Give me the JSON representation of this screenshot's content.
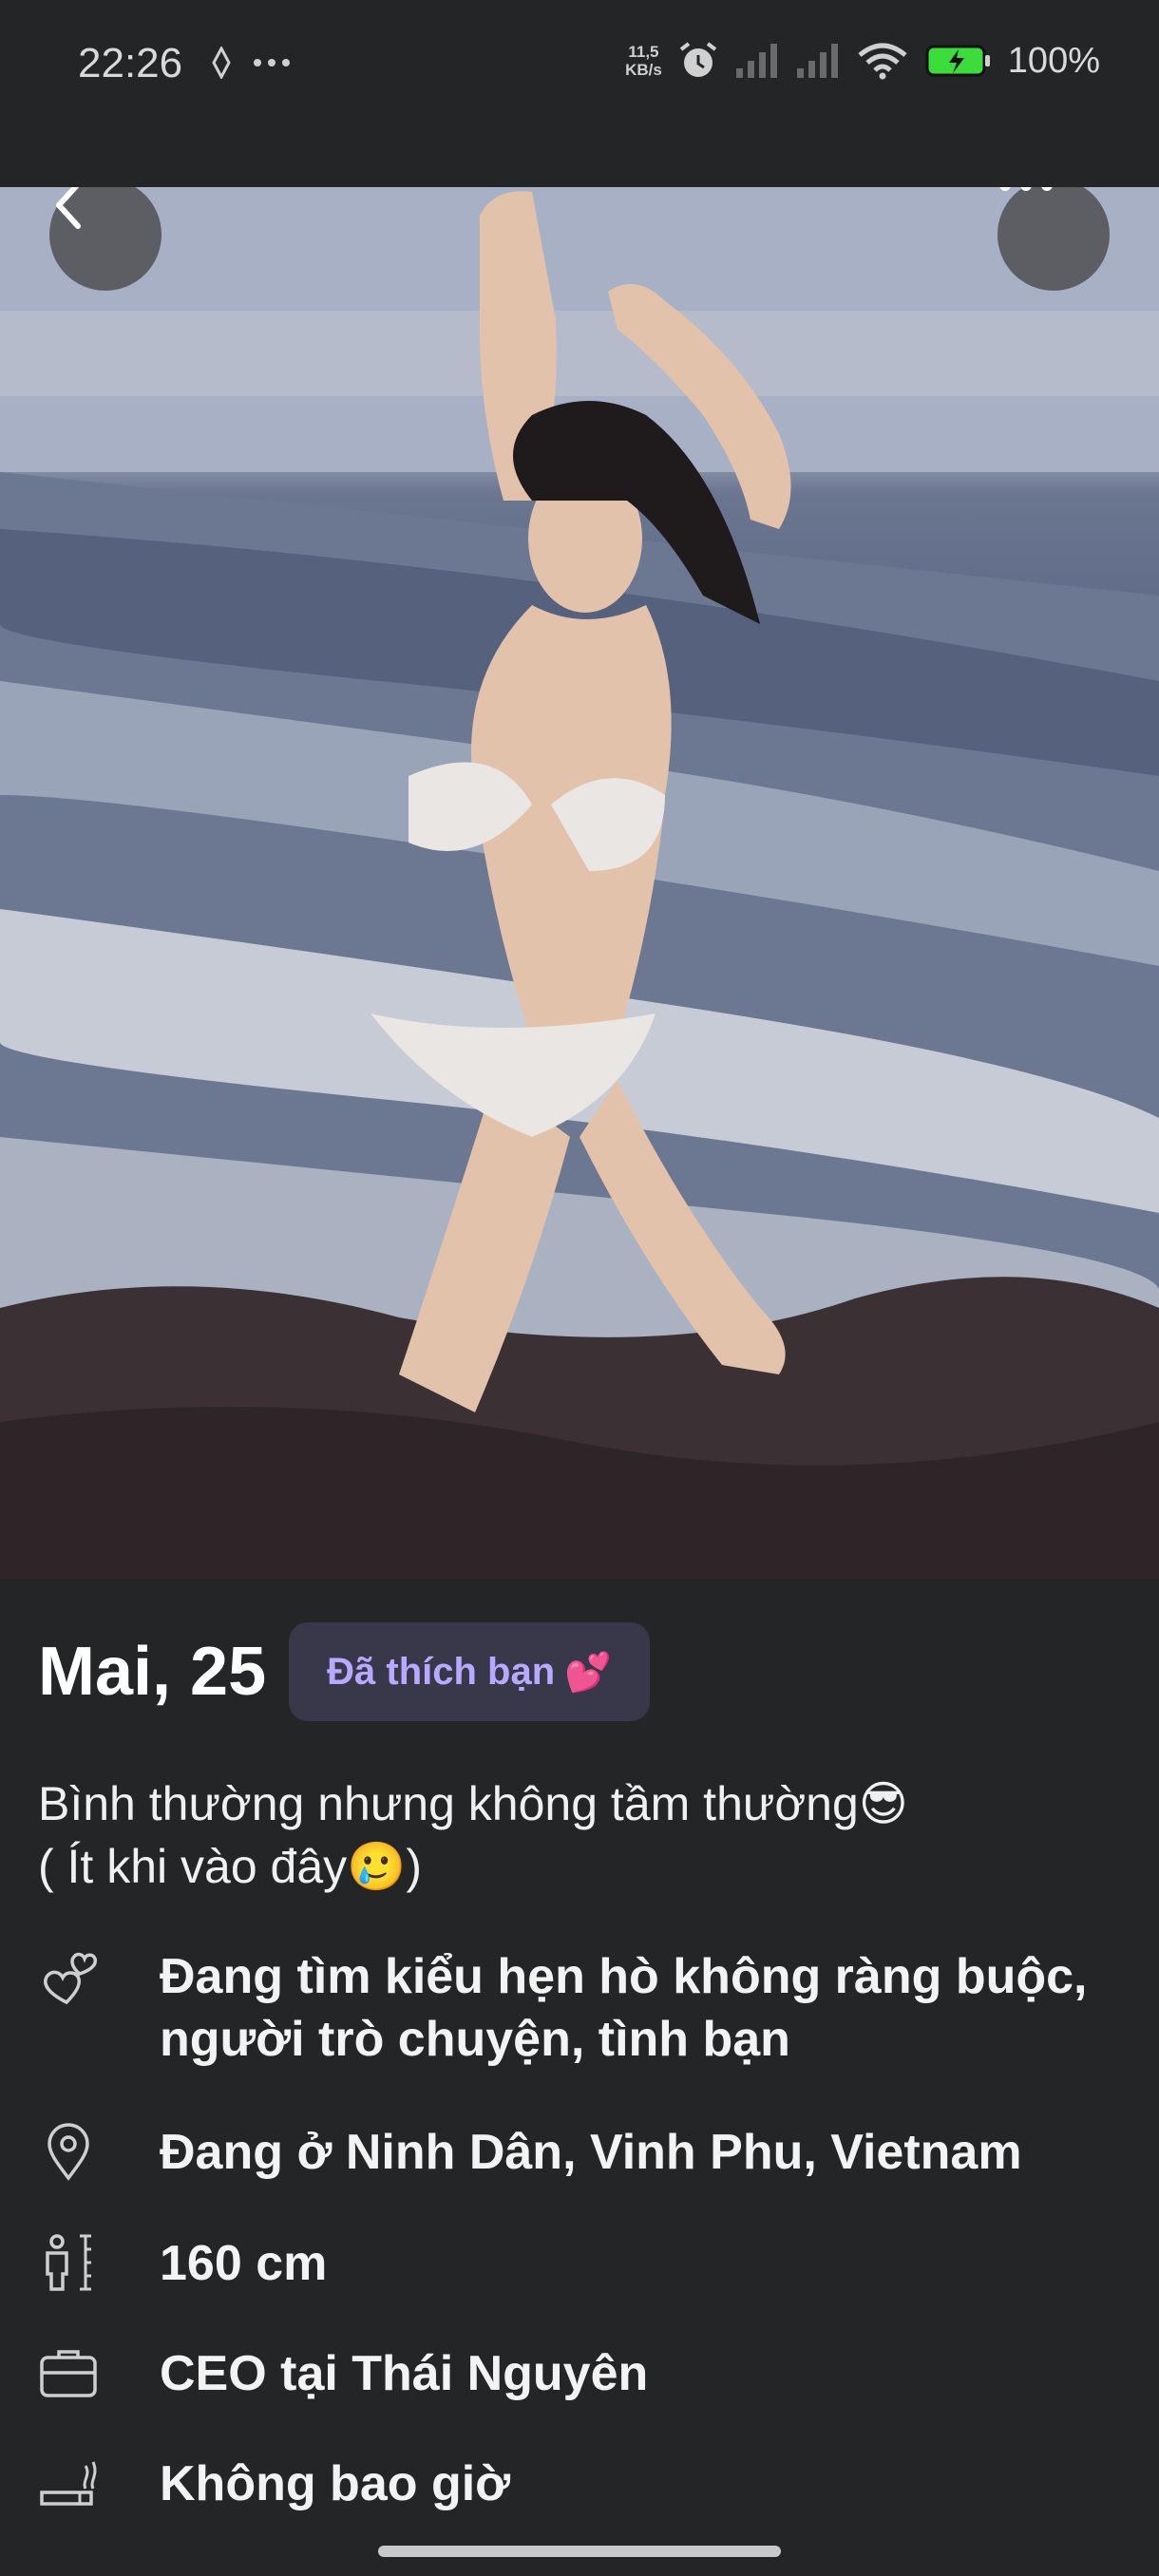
{
  "status_bar": {
    "time": "22:26",
    "left_icons": [
      "location-icon",
      "more-dots-icon"
    ],
    "speed_value": "11,5",
    "speed_unit": "KB/s",
    "battery_text": "100%",
    "icons": [
      "alarm-icon",
      "signal-icon",
      "signal-icon",
      "wifi-icon",
      "battery-charging-icon"
    ]
  },
  "photo": {
    "alt": "Profile photo",
    "back_icon": "chevron-left-icon",
    "more_icon": "more-horizontal-icon"
  },
  "profile": {
    "name_age": "Mai, 25",
    "like_badge": "Đã thích bạn",
    "like_badge_emoji": "💕",
    "bio_line1": "Bình thường nhưng không tầm thường😎",
    "bio_line2": "( Ít khi vào đây🥲)",
    "looking_for": "Đang tìm kiểu hẹn hò không ràng buộc, người trò chuyện, tình bạn",
    "location": "Đang ở Ninh Dân, Vinh Phu, Vietnam",
    "height": "160 cm",
    "job": "CEO tại Thái Nguyên",
    "smoking": "Không bao giờ"
  },
  "colors": {
    "background": "#242527",
    "badge_bg": "#39374a",
    "badge_text": "#b9a8ff",
    "battery_green": "#3ddc3d"
  }
}
